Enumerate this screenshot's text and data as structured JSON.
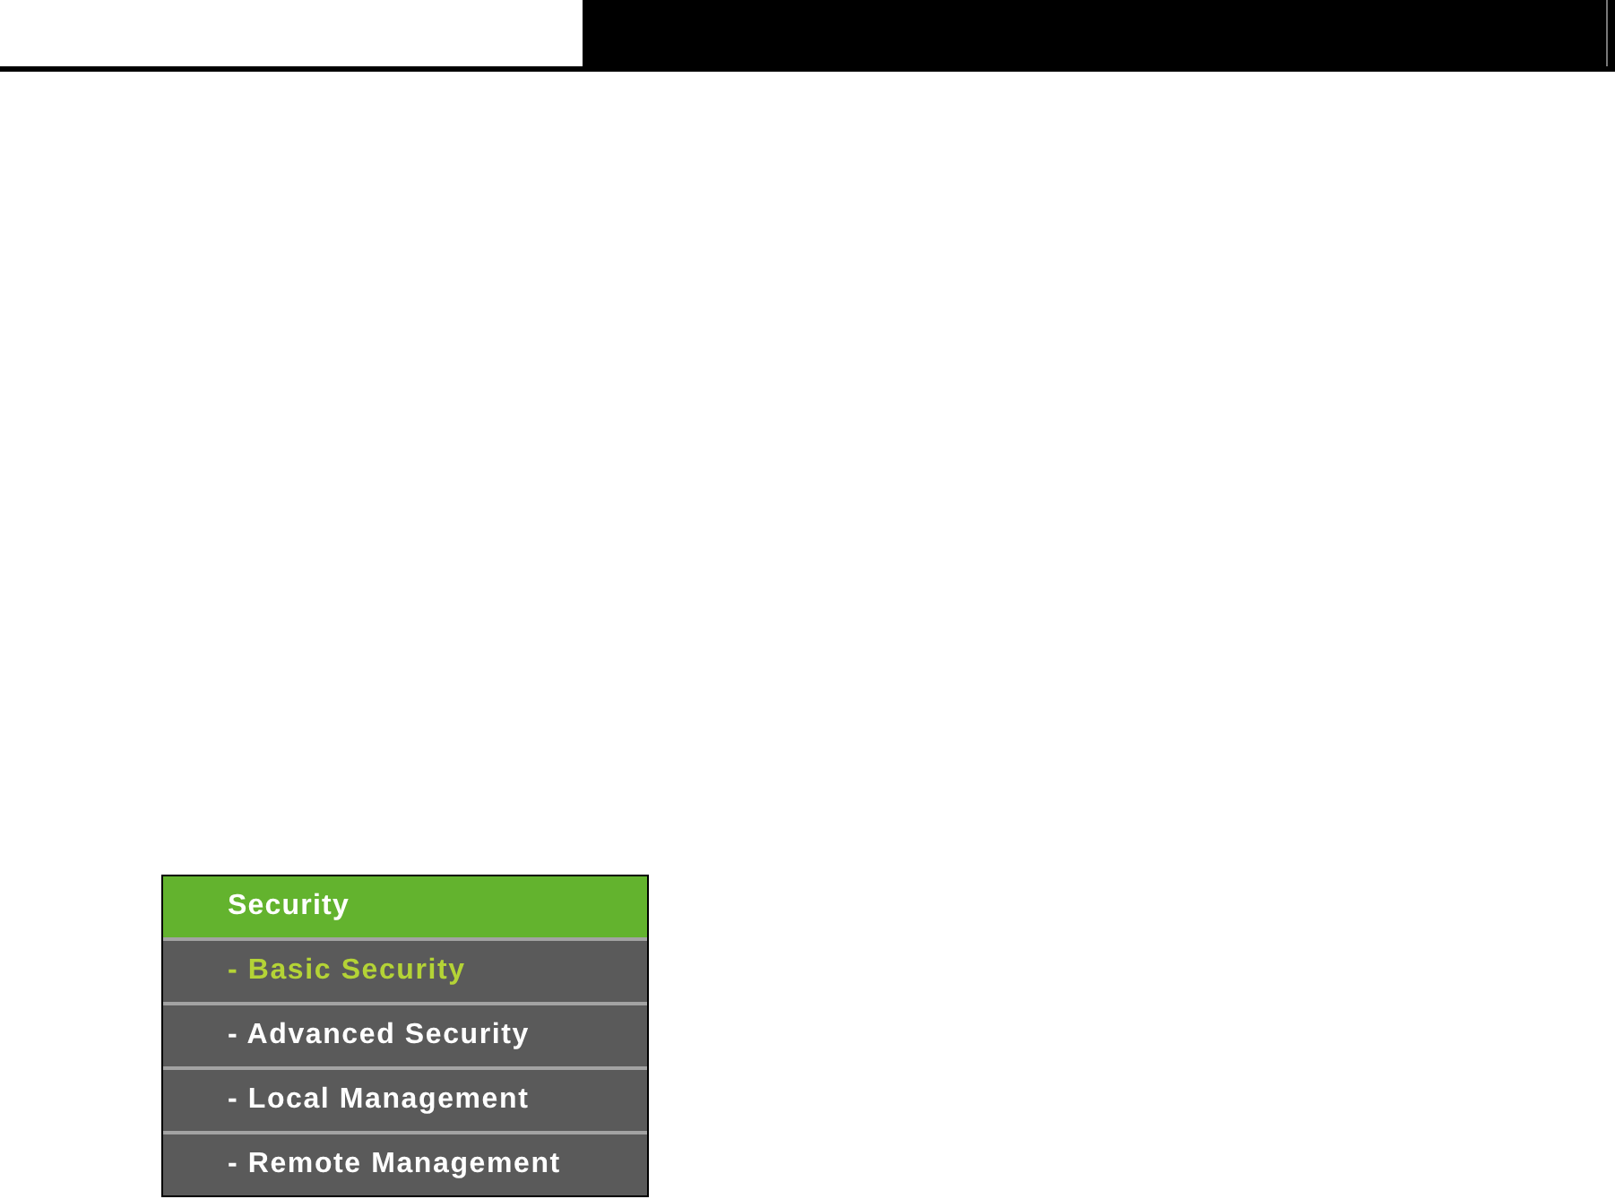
{
  "menu": {
    "heading": "Security",
    "items": [
      {
        "label": "- Basic Security",
        "selected": true
      },
      {
        "label": "- Advanced Security",
        "selected": false
      },
      {
        "label": "- Local Management",
        "selected": false
      },
      {
        "label": "- Remote Management",
        "selected": false
      }
    ]
  }
}
